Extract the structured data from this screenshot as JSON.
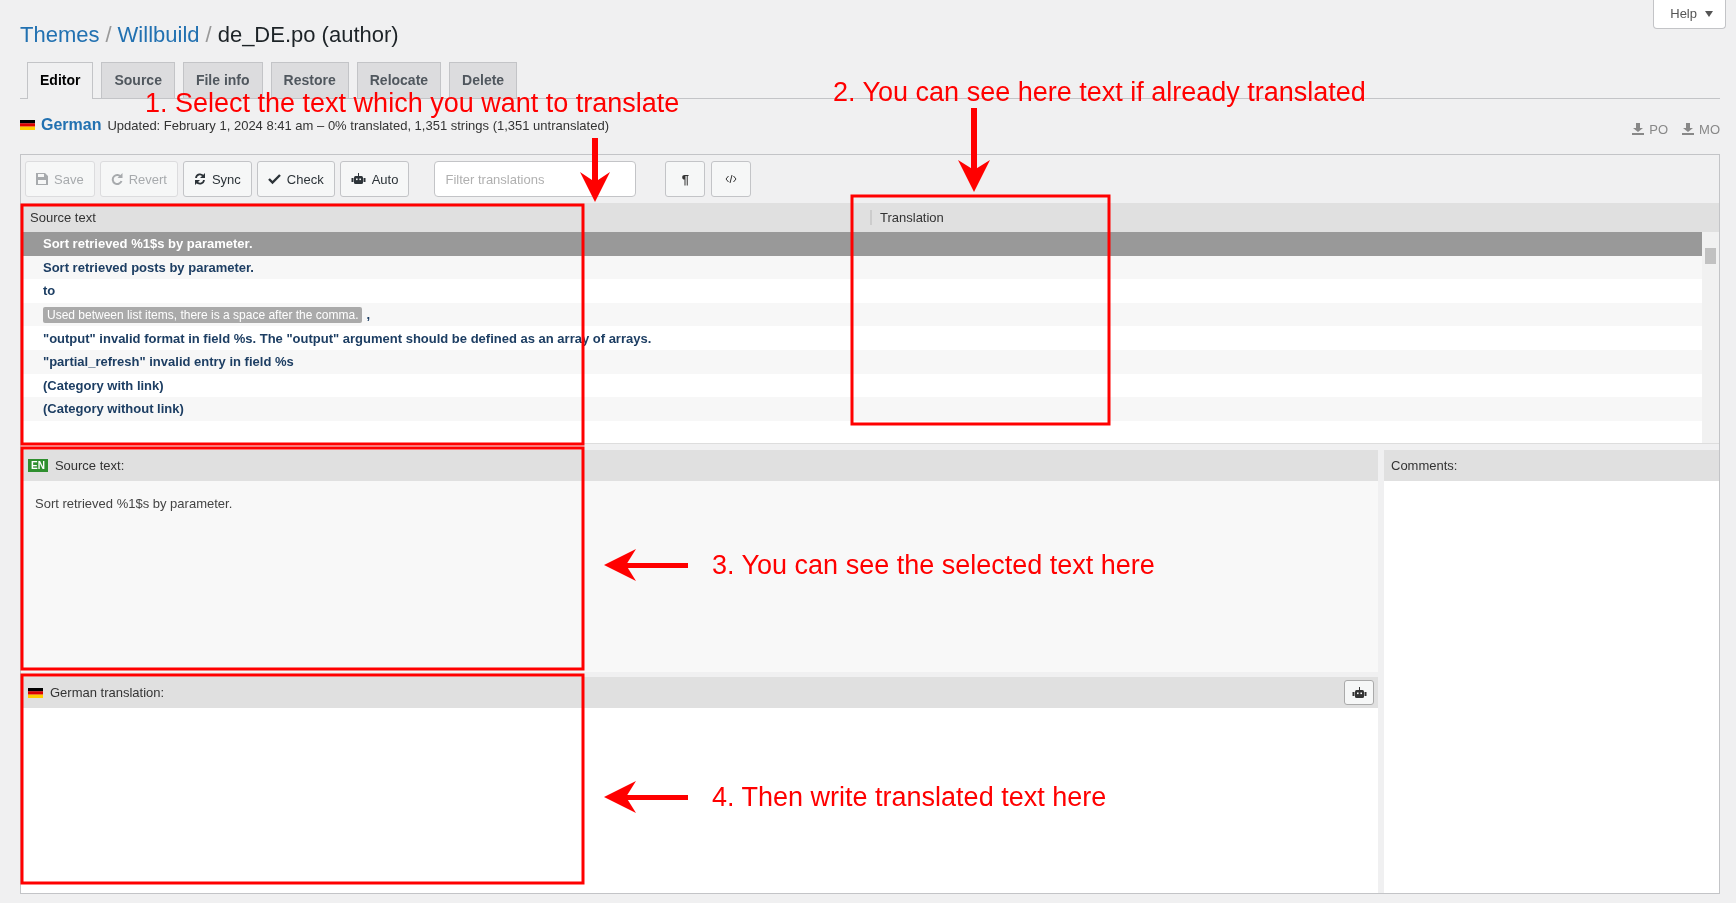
{
  "breadcrumb": [
    {
      "label": "Themes",
      "kind": "link"
    },
    {
      "label": "Willbuild",
      "kind": "link"
    },
    {
      "label": "de_DE.po (author)",
      "kind": "current"
    }
  ],
  "breadcrumb_separator": "/",
  "help": {
    "label": "Help"
  },
  "tabs": [
    {
      "label": "Editor",
      "selected": true
    },
    {
      "label": "Source",
      "selected": false
    },
    {
      "label": "File info",
      "selected": false
    },
    {
      "label": "Restore",
      "selected": false
    },
    {
      "label": "Relocate",
      "selected": false
    },
    {
      "label": "Delete",
      "selected": false
    }
  ],
  "locale": {
    "language": "German",
    "meta": "Updated: February 1, 2024 8:41 am – 0% translated, 1,351 strings (1,351 untranslated)"
  },
  "downloads": [
    "PO",
    "MO"
  ],
  "toolbar": [
    {
      "label": "Save",
      "kind": "save",
      "disabled": true
    },
    {
      "label": "Revert",
      "kind": "revert",
      "disabled": true
    },
    {
      "label": "Sync",
      "kind": "sync",
      "disabled": false
    },
    {
      "label": "Check",
      "kind": "check",
      "disabled": false
    },
    {
      "label": "Auto",
      "kind": "auto",
      "disabled": false
    }
  ],
  "filter": {
    "placeholder": "Filter translations"
  },
  "toggles": [
    {
      "kind": "char",
      "label": "¶"
    },
    {
      "kind": "code"
    }
  ],
  "list": {
    "columns": [
      "Source text",
      "Translation"
    ],
    "rows": [
      {
        "kind": "text",
        "text": "Sort retrieved %1$s by parameter.",
        "selected": true
      },
      {
        "kind": "text",
        "text": "Sort retrieved posts by parameter.",
        "selected": false
      },
      {
        "kind": "text",
        "text": "to",
        "selected": false
      },
      {
        "kind": "context",
        "context": "Used between list items, there is a space after the comma.",
        "text": ",",
        "selected": false
      },
      {
        "kind": "text",
        "text": "\"output\" invalid format in field %s. The \"output\" argument should be defined as an array of arrays.",
        "selected": false
      },
      {
        "kind": "text",
        "text": "\"partial_refresh\" invalid entry in field %s",
        "selected": false
      },
      {
        "kind": "text",
        "text": "(Category with link)",
        "selected": false
      },
      {
        "kind": "text",
        "text": "(Category without link)",
        "selected": false
      }
    ]
  },
  "source_panel": {
    "badge": "EN",
    "label": "Source text:",
    "text": "Sort retrieved %1$s by parameter."
  },
  "translation_panel": {
    "label": "German translation:"
  },
  "comments_panel": {
    "label": "Comments:"
  },
  "annotations": [
    "1. Select the text which you want to translate",
    "2. You can see here text if already translated",
    "3. You can see the selected text here",
    "4. Then write translated text here"
  ]
}
